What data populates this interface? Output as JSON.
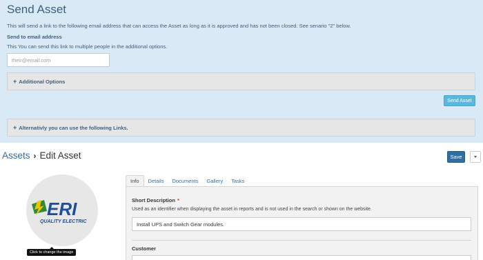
{
  "send_asset": {
    "title": "Send Asset",
    "description": "This will send a link to the following email address that can access the Asset as long as it is approved and has not been closed. See senario \"2\" below.",
    "email_label": "Send to email address",
    "email_sublabel": "This You can send this link to multiple people in the additional options.",
    "email_placeholder": "their@email.com",
    "email_value": "",
    "additional_options_label": "Additional Options",
    "send_button_label": "Send Asset",
    "alt_links_label": "Alternativly you can use the following Links."
  },
  "header": {
    "breadcrumb_root": "Assets",
    "breadcrumb_current": "Edit Asset",
    "save_label": "Save"
  },
  "logo": {
    "text": "ERI",
    "subtext": "QUALITY ELECTRIC",
    "tooltip": "Click to change the image",
    "colors": {
      "blue": "#1f4e9c",
      "green": "#2d8a3c",
      "yellow": "#f2c200"
    }
  },
  "tabs": [
    {
      "label": "Info",
      "active": true
    },
    {
      "label": "Details",
      "active": false
    },
    {
      "label": "Documents",
      "active": false
    },
    {
      "label": "Gallery",
      "active": false
    },
    {
      "label": "Tasks",
      "active": false
    }
  ],
  "form": {
    "short_description": {
      "label": "Short Description",
      "required_mark": "*",
      "help": "Used as an identifier when displaying the asset in reports and is not used in the search or shown on the website.",
      "value": "Install UPS and Switch Gear modules."
    },
    "customer": {
      "label": "Customer"
    }
  },
  "colors": {
    "panel_bg": "#d9e9f6",
    "link": "#2f6fa5",
    "send_button": "#5bb8dc",
    "required": "#d9302d"
  }
}
